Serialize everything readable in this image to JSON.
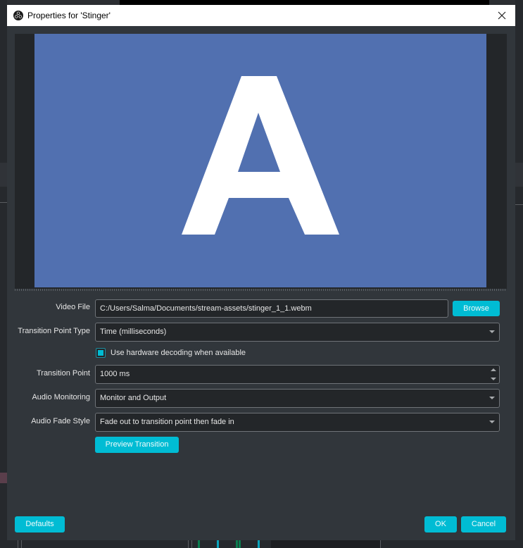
{
  "window": {
    "title": "Properties for 'Stinger'",
    "icon": "obs-logo-icon",
    "close_icon": "close-icon"
  },
  "preview": {
    "letter": "A",
    "background_color": "#5170b0",
    "letter_color": "#ffffff"
  },
  "form": {
    "video_file": {
      "label": "Video File",
      "value": "C:/Users/Salma/Documents/stream-assets/stinger_1_1.webm",
      "browse_label": "Browse"
    },
    "transition_point_type": {
      "label": "Transition Point Type",
      "value": "Time (milliseconds)"
    },
    "hardware_decoding": {
      "label": "Use hardware decoding when available",
      "checked": true
    },
    "transition_point": {
      "label": "Transition Point",
      "value": "1000 ms"
    },
    "audio_monitoring": {
      "label": "Audio Monitoring",
      "value": "Monitor and Output"
    },
    "audio_fade_style": {
      "label": "Audio Fade Style",
      "value": "Fade out to transition point then fade in"
    },
    "preview_transition_label": "Preview Transition"
  },
  "footer": {
    "defaults_label": "Defaults",
    "ok_label": "OK",
    "cancel_label": "Cancel"
  },
  "colors": {
    "accent": "#00bcd4",
    "dialog_bg": "#31363b",
    "field_bg": "#232629"
  }
}
